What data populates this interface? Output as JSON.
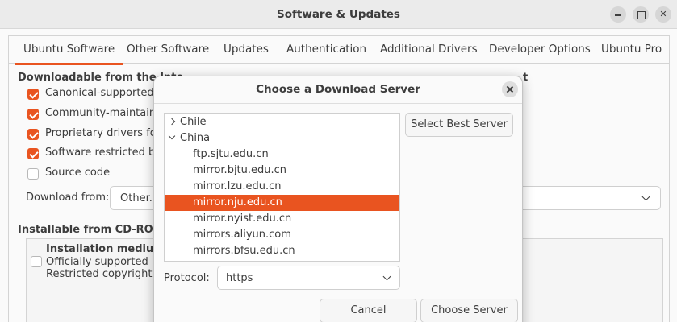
{
  "window": {
    "title": "Software & Updates"
  },
  "tabs": [
    "Ubuntu Software",
    "Other Software",
    "Updates",
    "Authentication",
    "Additional Drivers",
    "Developer Options",
    "Ubuntu Pro"
  ],
  "downloadable": {
    "heading": "Downloadable from the Inte",
    "heading_tail": "t",
    "items": [
      {
        "label": "Canonical-supported fr",
        "checked": true
      },
      {
        "label": "Community-maintained",
        "checked": true
      },
      {
        "label": "Proprietary drivers for",
        "checked": true
      },
      {
        "label": "Software restricted by c",
        "checked": true
      },
      {
        "label": "Source code",
        "checked": false
      }
    ],
    "download_from_label": "Download from:",
    "download_from_value": "Other..."
  },
  "cdrom": {
    "heading": "Installable from CD-ROM/D",
    "item_title": "Installation medium w",
    "item_line1": "Officially supported",
    "item_line2": "Restricted copyright"
  },
  "dialog": {
    "title": "Choose a Download Server",
    "tree": [
      {
        "label": "Chile",
        "kind": "country",
        "expanded": false
      },
      {
        "label": "China",
        "kind": "country",
        "expanded": true
      },
      {
        "label": "ftp.sjtu.edu.cn",
        "kind": "server"
      },
      {
        "label": "mirror.bjtu.edu.cn",
        "kind": "server"
      },
      {
        "label": "mirror.lzu.edu.cn",
        "kind": "server"
      },
      {
        "label": "mirror.nju.edu.cn",
        "kind": "server",
        "selected": true
      },
      {
        "label": "mirror.nyist.edu.cn",
        "kind": "server"
      },
      {
        "label": "mirrors.aliyun.com",
        "kind": "server"
      },
      {
        "label": "mirrors.bfsu.edu.cn",
        "kind": "server"
      }
    ],
    "select_best_label": "Select Best Server",
    "protocol_label": "Protocol:",
    "protocol_value": "https",
    "cancel_label": "Cancel",
    "choose_label": "Choose Server"
  },
  "colors": {
    "accent": "#e95420"
  }
}
